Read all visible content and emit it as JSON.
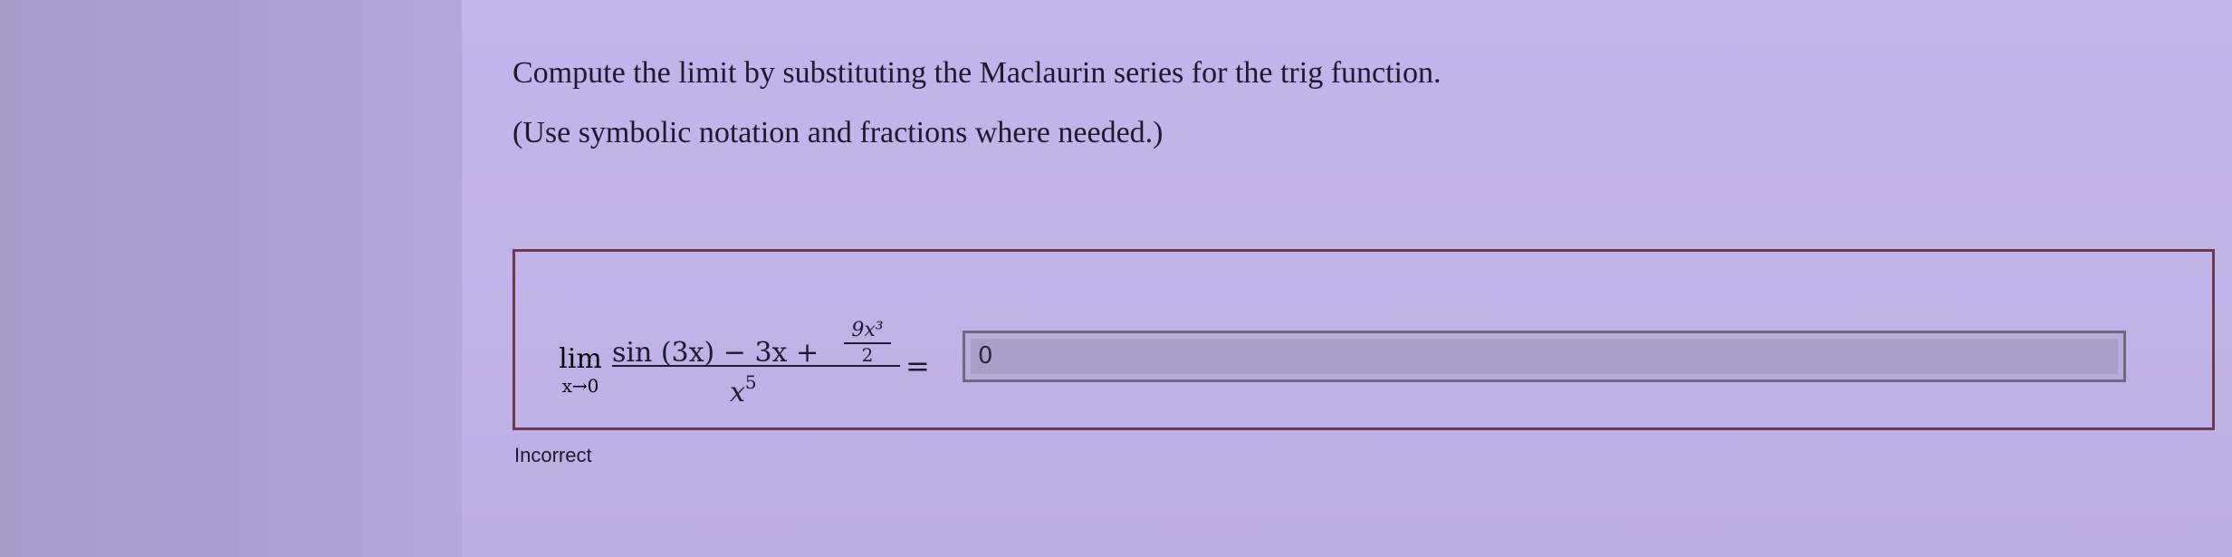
{
  "question": {
    "prompt": "Compute the limit by substituting the Maclaurin series for the trig function.",
    "hint": "(Use symbolic notation and fractions where needed.)"
  },
  "expression": {
    "lim_word": "lim",
    "lim_sub": "x→0",
    "numerator_main": "sin (3x) − 3x +",
    "inner_fraction_numerator": "9x³",
    "inner_fraction_denominator": "2",
    "denominator": "x",
    "denominator_exponent": "5",
    "equals": "="
  },
  "answer": {
    "value": "0"
  },
  "feedback": {
    "status": "Incorrect"
  }
}
